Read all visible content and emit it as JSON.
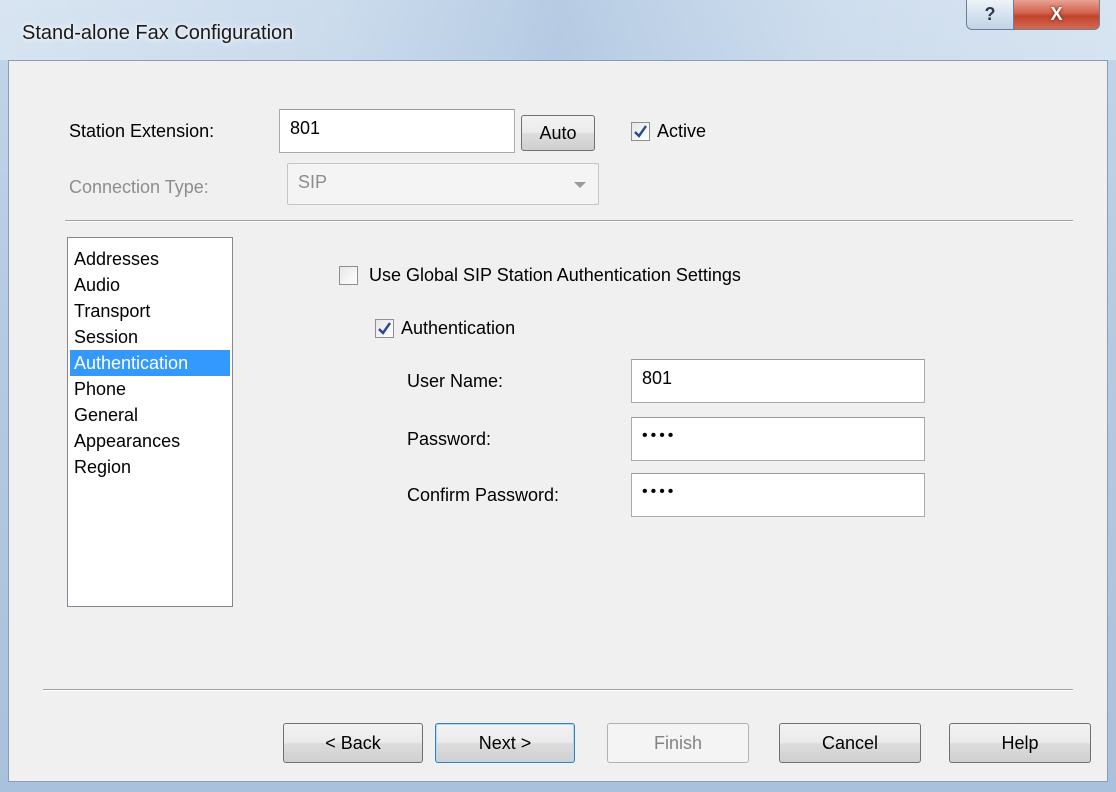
{
  "window": {
    "title": "Stand-alone Fax Configuration",
    "help_glyph": "?",
    "close_glyph": "X"
  },
  "station": {
    "extension_label": "Station Extension:",
    "extension_value": "801",
    "auto_label": "Auto",
    "active_label": "Active",
    "active_checked": true,
    "connection_type_label": "Connection Type:",
    "connection_type_value": "SIP"
  },
  "sidebar": {
    "items": [
      {
        "label": "Addresses",
        "selected": false
      },
      {
        "label": "Audio",
        "selected": false
      },
      {
        "label": "Transport",
        "selected": false
      },
      {
        "label": "Session",
        "selected": false
      },
      {
        "label": "Authentication",
        "selected": true
      },
      {
        "label": "Phone",
        "selected": false
      },
      {
        "label": "General",
        "selected": false
      },
      {
        "label": "Appearances",
        "selected": false
      },
      {
        "label": "Region",
        "selected": false
      }
    ]
  },
  "auth": {
    "use_global_label": "Use Global SIP Station Authentication Settings",
    "use_global_checked": false,
    "authentication_label": "Authentication",
    "authentication_checked": true,
    "username_label": "User Name:",
    "username_value": "801",
    "password_label": "Password:",
    "password_value": "••••",
    "confirm_label": "Confirm Password:",
    "confirm_value": "••••"
  },
  "footer": {
    "back_label": "< Back",
    "next_label": "Next >",
    "finish_label": "Finish",
    "cancel_label": "Cancel",
    "help_label": "Help"
  },
  "colors": {
    "selection": "#3399ff",
    "dialog_bg": "#f0f0f0",
    "close_button": "#c2432d"
  }
}
